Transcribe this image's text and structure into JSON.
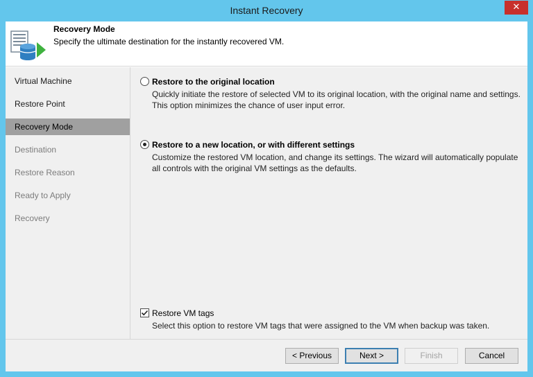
{
  "window": {
    "title": "Instant Recovery",
    "close_glyph": "✕"
  },
  "header": {
    "title": "Recovery Mode",
    "subtitle": "Specify the ultimate destination for the instantly recovered VM.",
    "icon": "vm-restore-icon"
  },
  "steps": [
    {
      "label": "Virtual Machine",
      "state": "done"
    },
    {
      "label": "Restore Point",
      "state": "done"
    },
    {
      "label": "Recovery Mode",
      "state": "active"
    },
    {
      "label": "Destination",
      "state": "disabled"
    },
    {
      "label": "Restore Reason",
      "state": "disabled"
    },
    {
      "label": "Ready to Apply",
      "state": "disabled"
    },
    {
      "label": "Recovery",
      "state": "disabled"
    }
  ],
  "options": {
    "original": {
      "label": "Restore to the original location",
      "description": "Quickly initiate the restore of selected VM to its original location, with the original name and settings. This option minimizes the chance of user input error.",
      "selected": false
    },
    "new_location": {
      "label": "Restore to a new location, or with different settings",
      "description": "Customize the restored VM location, and change its settings. The wizard will automatically populate all controls with the original VM settings as the defaults.",
      "selected": true
    }
  },
  "restore_tags": {
    "label": "Restore VM tags",
    "description": "Select this option to restore VM tags that were assigned to the VM when backup was taken.",
    "checked": true
  },
  "buttons": {
    "previous": "< Previous",
    "next": "Next >",
    "finish": "Finish",
    "cancel": "Cancel"
  },
  "colors": {
    "titlebar": "#63c6ec",
    "close": "#c7302c",
    "active_step": "#a0a0a0"
  }
}
